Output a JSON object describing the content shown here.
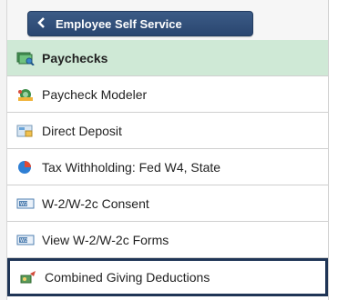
{
  "header": {
    "back_label": "Employee Self Service"
  },
  "menu": {
    "items": [
      {
        "label": "Paychecks",
        "icon": "paychecks-icon",
        "selected": true
      },
      {
        "label": "Paycheck Modeler",
        "icon": "paycheck-modeler-icon"
      },
      {
        "label": "Direct Deposit",
        "icon": "direct-deposit-icon"
      },
      {
        "label": "Tax Withholding: Fed W4, State",
        "icon": "tax-withholding-icon"
      },
      {
        "label": "W-2/W-2c Consent",
        "icon": "w2-consent-icon"
      },
      {
        "label": "View W-2/W-2c Forms",
        "icon": "w2-forms-icon"
      },
      {
        "label": "Combined Giving Deductions",
        "icon": "giving-icon",
        "focused": true
      }
    ]
  },
  "colors": {
    "header_button": "#2f4d77",
    "selected_row": "#cfe9d6",
    "focus_border": "#1f3556"
  }
}
